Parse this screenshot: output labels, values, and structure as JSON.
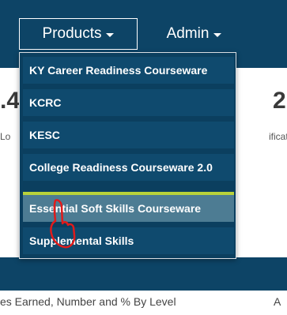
{
  "nav": {
    "products_label": "Products",
    "admin_label": "Admin"
  },
  "dropdown": {
    "items": [
      {
        "label": "KY Career Readiness Courseware"
      },
      {
        "label": "KCRC"
      },
      {
        "label": "KESC"
      },
      {
        "label": "College Readiness Courseware 2.0"
      },
      {
        "label": "Essential Soft Skills Courseware"
      },
      {
        "label": "Supplemental Skills"
      }
    ],
    "selected_index": 4
  },
  "background": {
    "digit_left": ".4",
    "digit_right": "2",
    "faint_left": "Lo",
    "faint_right": "ificat",
    "footer_left": "es Earned, Number and % By Level",
    "footer_right": "A"
  },
  "colors": {
    "navbar": "#0d4466",
    "menu_bg": "#0f4a6e",
    "selected": "#4d7c93",
    "accent_line": "#b8d23a",
    "cursor_annotation": "#e11b1b"
  },
  "icons": {
    "caret": "caret-down-icon",
    "cursor": "hand-pointer-icon"
  }
}
